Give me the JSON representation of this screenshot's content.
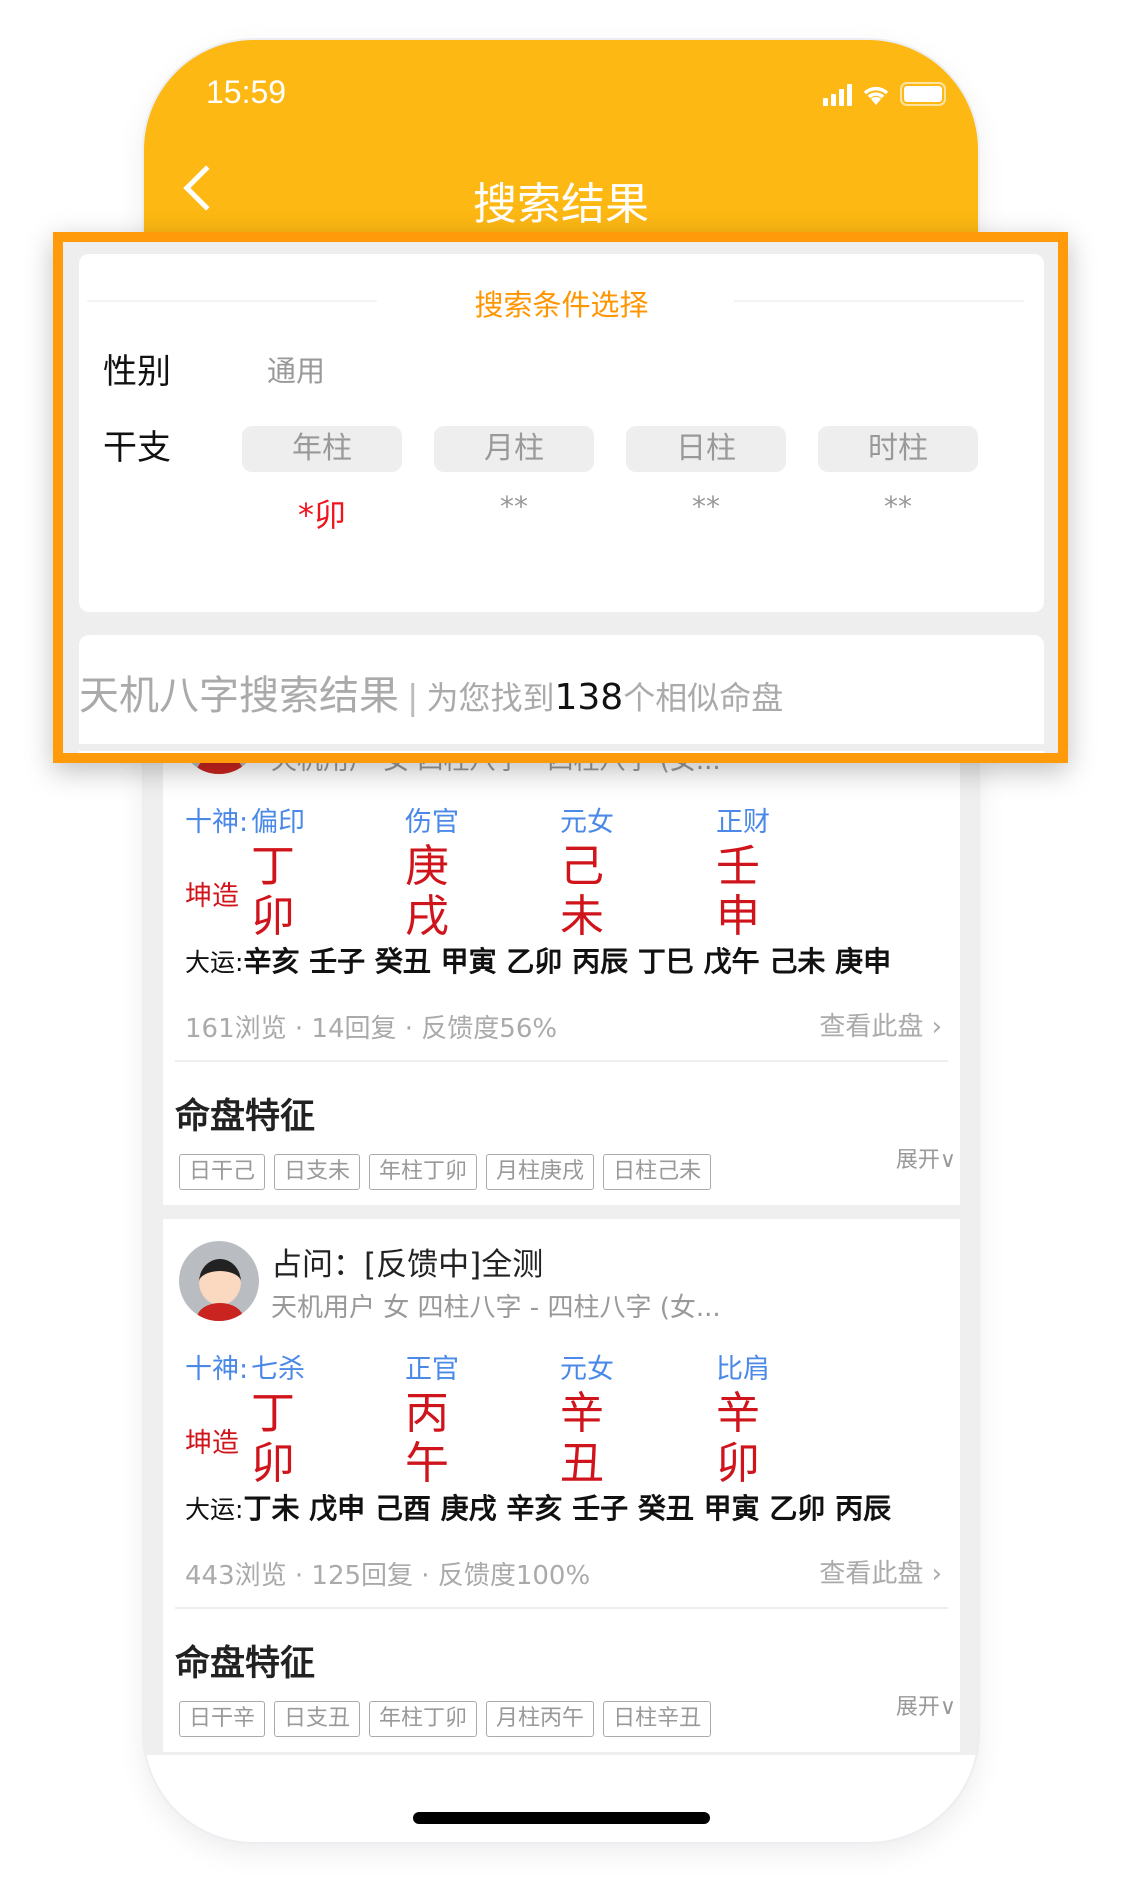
{
  "status_bar": {
    "time": "15:59"
  },
  "header": {
    "title": "搜索结果"
  },
  "search_panel": {
    "title": "搜索条件选择",
    "gender_label": "性别",
    "gender_value": "通用",
    "ganzhi_label": "干支",
    "pillars": [
      {
        "label": "年柱",
        "value": "*卯",
        "active": true
      },
      {
        "label": "月柱",
        "value": "**"
      },
      {
        "label": "日柱",
        "value": "**"
      },
      {
        "label": "时柱",
        "value": "**"
      }
    ]
  },
  "results_header": {
    "title": "天机八字搜索结果",
    "separator": "|",
    "prefix": "为您找到",
    "count": "138",
    "suffix": "个相似命盘"
  },
  "cards": [
    {
      "subtitle": "天机用户 女 四柱八字 - 四柱八字 (女...",
      "shishen_label": "十神:",
      "shishen": [
        "偏印",
        "伤官",
        "元女",
        "正财"
      ],
      "kunzao_label": "坤造",
      "stems": [
        "丁",
        "庚",
        "己",
        "壬"
      ],
      "branches": [
        "卯",
        "戌",
        "未",
        "申"
      ],
      "dayun_label": "大运:",
      "dayun": "辛亥 壬子 癸丑 甲寅 乙卯 丙辰 丁巳 戊午 己未 庚申",
      "stats": "161浏览 · 14回复  · 反馈度56%",
      "view_label": "查看此盘",
      "feature_title": "命盘特征",
      "tags": [
        "日干己",
        "日支未",
        "年柱丁卯",
        "月柱庚戌",
        "日柱己未"
      ],
      "expand_label": "展开"
    },
    {
      "title": "占问：[反馈中]全测",
      "subtitle": "天机用户 女 四柱八字 - 四柱八字 (女...",
      "shishen_label": "十神:",
      "shishen": [
        "七杀",
        "正官",
        "元女",
        "比肩"
      ],
      "kunzao_label": "坤造",
      "stems": [
        "丁",
        "丙",
        "辛",
        "辛"
      ],
      "branches": [
        "卯",
        "午",
        "丑",
        "卯"
      ],
      "dayun_label": "大运:",
      "dayun": "丁未 戊申 己酉 庚戌 辛亥 壬子 癸丑 甲寅 乙卯 丙辰",
      "stats": "443浏览 · 125回复  · 反馈度100%",
      "view_label": "查看此盘",
      "feature_title": "命盘特征",
      "tags": [
        "日干辛",
        "日支丑",
        "年柱丁卯",
        "月柱丙午",
        "日柱辛丑"
      ],
      "expand_label": "展开"
    }
  ],
  "colors": {
    "header": "#fdb813",
    "highlight_border": "#ff9a0a",
    "accent": "#ff9500",
    "shishen": "#4a89e8",
    "ganzhi": "#d0141b"
  }
}
